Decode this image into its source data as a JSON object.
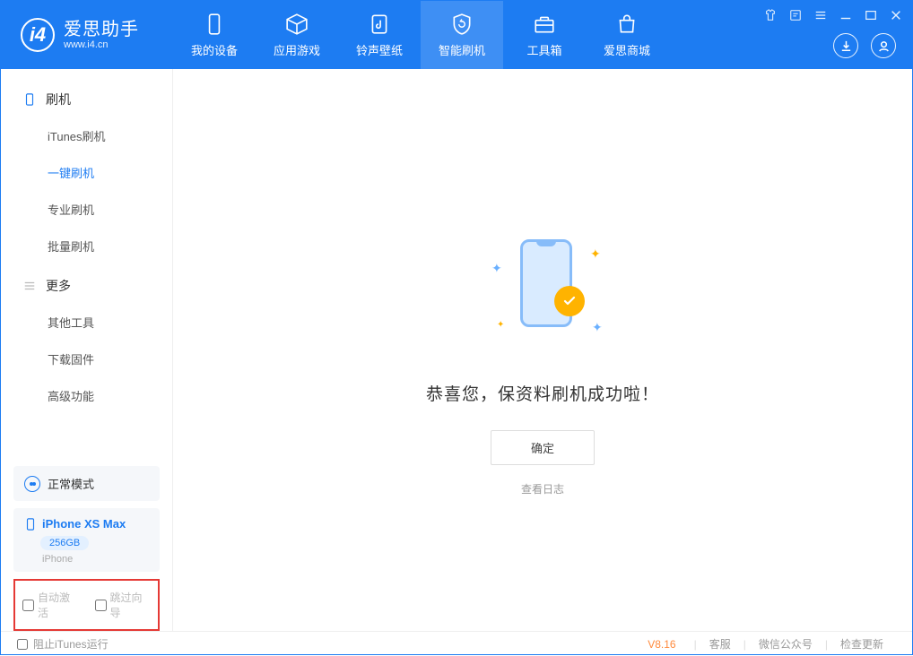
{
  "app": {
    "name_cn": "爱思助手",
    "name_en": "www.i4.cn"
  },
  "nav": {
    "tabs": [
      {
        "label": "我的设备"
      },
      {
        "label": "应用游戏"
      },
      {
        "label": "铃声壁纸"
      },
      {
        "label": "智能刷机"
      },
      {
        "label": "工具箱"
      },
      {
        "label": "爱思商城"
      }
    ],
    "active_index": 3
  },
  "sidebar": {
    "groups": [
      {
        "title": "刷机",
        "items": [
          {
            "label": "iTunes刷机"
          },
          {
            "label": "一键刷机"
          },
          {
            "label": "专业刷机"
          },
          {
            "label": "批量刷机"
          }
        ],
        "active_index": 1
      },
      {
        "title": "更多",
        "items": [
          {
            "label": "其他工具"
          },
          {
            "label": "下载固件"
          },
          {
            "label": "高级功能"
          }
        ]
      }
    ],
    "mode_label": "正常模式",
    "device": {
      "name": "iPhone XS Max",
      "storage": "256GB",
      "type": "iPhone"
    },
    "options": {
      "auto_activate": "自动激活",
      "skip_guide": "跳过向导"
    }
  },
  "main": {
    "success_title": "恭喜您，保资料刷机成功啦！",
    "confirm_label": "确定",
    "log_link": "查看日志"
  },
  "footer": {
    "block_itunes": "阻止iTunes运行",
    "version": "V8.16",
    "links": [
      "客服",
      "微信公众号",
      "检查更新"
    ]
  }
}
